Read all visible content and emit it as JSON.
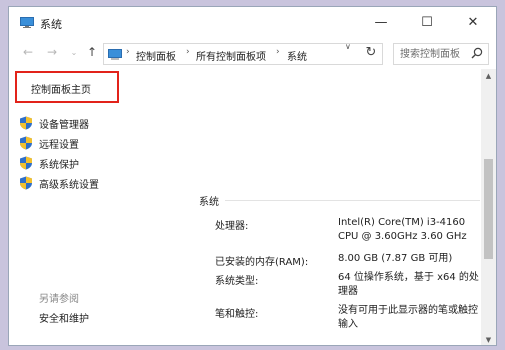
{
  "window": {
    "title": "系统",
    "minimize_glyph": "—",
    "maximize_glyph": "☐",
    "close_glyph": "✕",
    "accent": "#e2231a"
  },
  "navbar": {
    "back_glyph": "←",
    "forward_glyph": "→",
    "history_glyph": "⌄",
    "up_glyph": "↑",
    "breadcrumbs": [
      "控制面板",
      "所有控制面板项",
      "系统"
    ],
    "refresh_glyph": "↻",
    "search_placeholder": "搜索控制面板"
  },
  "sidebar": {
    "home_label": "控制面板主页",
    "items": [
      {
        "label": "设备管理器",
        "icon": "shield-icon"
      },
      {
        "label": "远程设置",
        "icon": "shield-icon"
      },
      {
        "label": "系统保护",
        "icon": "shield-icon"
      },
      {
        "label": "高级系统设置",
        "icon": "shield-icon"
      }
    ],
    "see_also_heading": "另请参阅",
    "see_also_links": [
      "安全和维护"
    ]
  },
  "main": {
    "section_title": "系统",
    "rows": [
      {
        "label": "处理器:",
        "value": "Intel(R) Core(TM) i3-4160 CPU @ 3.60GHz   3.60 GHz"
      },
      {
        "label": "已安装的内存(RAM):",
        "value": "8.00 GB (7.87 GB 可用)"
      },
      {
        "label": "系统类型:",
        "value": "64 位操作系统，基于 x64 的处理器"
      },
      {
        "label": "笔和触控:",
        "value": "没有可用于此显示器的笔或触控输入"
      }
    ]
  }
}
